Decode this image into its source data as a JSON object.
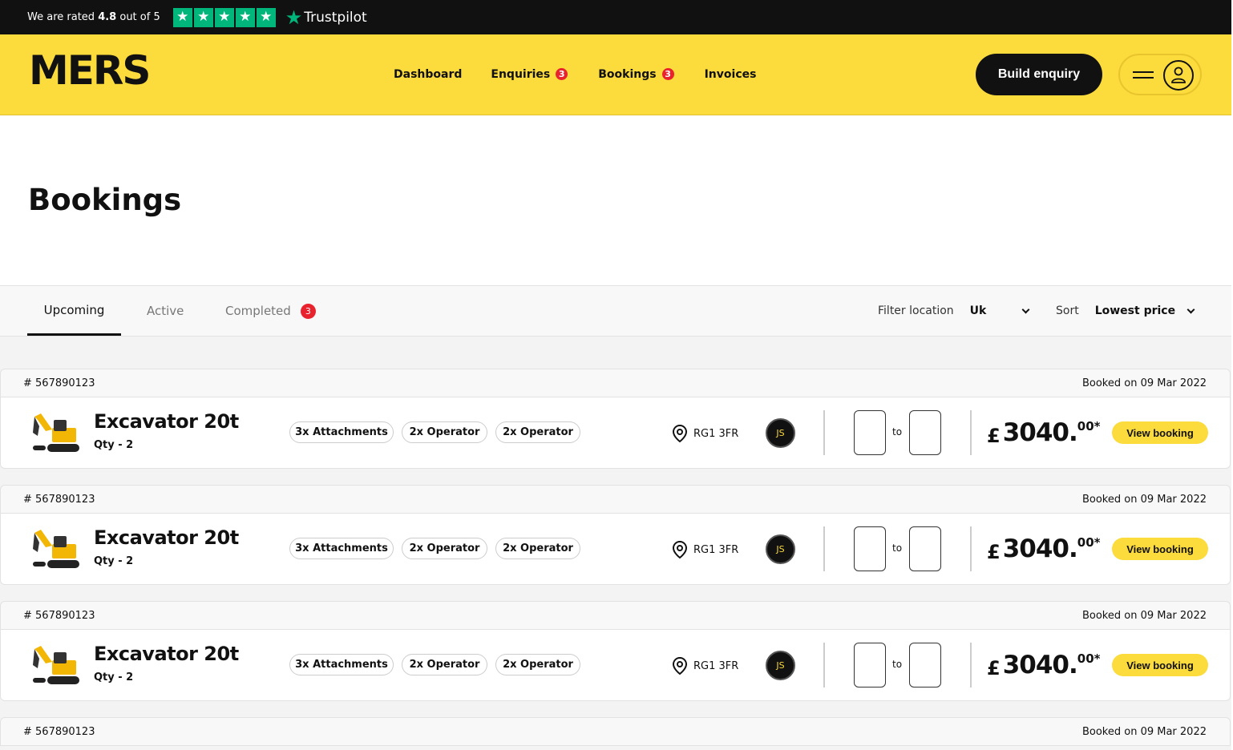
{
  "rating": {
    "prefix": "We are rated",
    "score": "4.8",
    "suffix": "out of 5",
    "stars": 5,
    "provider": "Trustpilot"
  },
  "header": {
    "logo": "MERS",
    "nav": [
      {
        "label": "Dashboard",
        "badge": ""
      },
      {
        "label": "Enquiries",
        "badge": "3"
      },
      {
        "label": "Bookings",
        "badge": "3"
      },
      {
        "label": "Invoices",
        "badge": ""
      }
    ],
    "build_label": "Build enquiry"
  },
  "page": {
    "title": "Bookings"
  },
  "tabs": [
    {
      "label": "Upcoming",
      "badge": ""
    },
    {
      "label": "Active",
      "badge": ""
    },
    {
      "label": "Completed",
      "badge": "3"
    }
  ],
  "filters": {
    "location_label": "Filter location",
    "location_value": "Uk",
    "sort_label": "Sort",
    "sort_value": "Lowest price"
  },
  "bookings": [
    {
      "id": "# 567890123",
      "booked": "Booked on 09 Mar 2022",
      "name": "Excavator 20t",
      "qty": "Qty - 2",
      "chips": [
        "3x Attachments",
        "2x Operator",
        "2x Operator"
      ],
      "location": "RG1 3FR",
      "initials": "JS",
      "to": "to",
      "currency": "£",
      "amount": "3040.",
      "decimals": "00*",
      "action": "View booking"
    },
    {
      "id": "# 567890123",
      "booked": "Booked on 09 Mar 2022",
      "name": "Excavator 20t",
      "qty": "Qty - 2",
      "chips": [
        "3x Attachments",
        "2x Operator",
        "2x Operator"
      ],
      "location": "RG1 3FR",
      "initials": "JS",
      "to": "to",
      "currency": "£",
      "amount": "3040.",
      "decimals": "00*",
      "action": "View booking"
    },
    {
      "id": "# 567890123",
      "booked": "Booked on 09 Mar 2022",
      "name": "Excavator 20t",
      "qty": "Qty - 2",
      "chips": [
        "3x Attachments",
        "2x Operator",
        "2x Operator"
      ],
      "location": "RG1 3FR",
      "initials": "JS",
      "to": "to",
      "currency": "£",
      "amount": "3040.",
      "decimals": "00*",
      "action": "View booking"
    },
    {
      "id": "# 567890123",
      "booked": "Booked on 09 Mar 2022"
    }
  ],
  "colors": {
    "brand_yellow": "#fcdb3d",
    "dark": "#111111",
    "badge_red": "#e8232d",
    "trustpilot_green": "#00b67a"
  },
  "icons": [
    "trustpilot-star-icon",
    "hamburger-menu-icon",
    "user-icon",
    "location-pin-icon",
    "chevron-down-icon",
    "excavator-image"
  ]
}
